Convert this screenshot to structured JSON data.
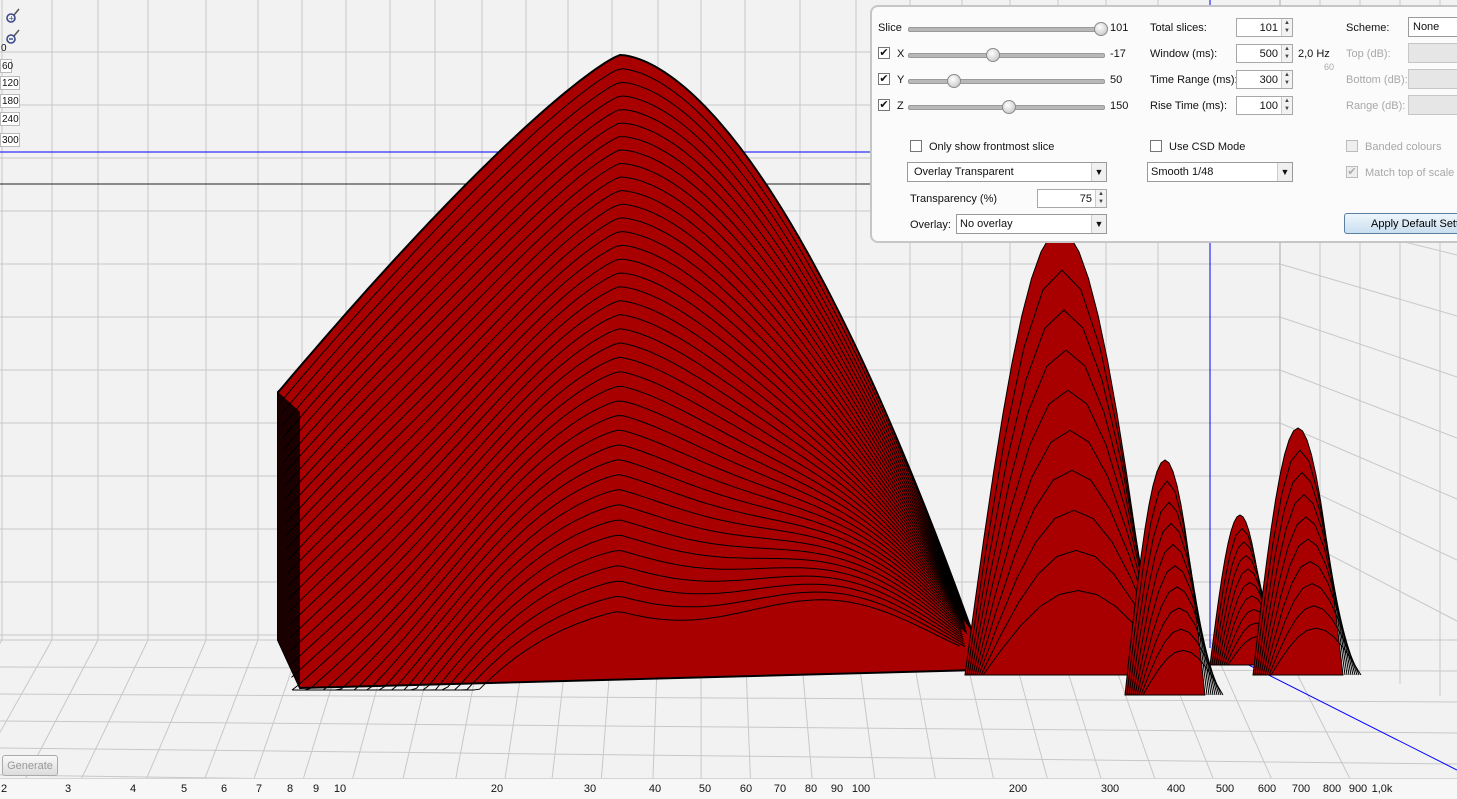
{
  "zoom": {
    "in_icon": "zoom-in-icon",
    "out_icon": "zoom-out-icon",
    "labels": [
      "0",
      "60",
      "120",
      "180",
      "240",
      "300"
    ]
  },
  "colors": {
    "fill": "#a80000",
    "edge": "#000000",
    "grid": "#c8c8c8",
    "blue_line": "#0000ff"
  },
  "axis_ticks": [
    "2",
    "3",
    "4",
    "5",
    "6",
    "7",
    "8",
    "9",
    "10",
    "20",
    "30",
    "40",
    "50",
    "60",
    "70",
    "80",
    "90",
    "100",
    "200",
    "300",
    "400",
    "500",
    "600",
    "700",
    "800",
    "900",
    "1,0k"
  ],
  "generate_label": "Generate",
  "panel": {
    "slice": {
      "label": "Slice",
      "value": "101",
      "fraction": 1.0
    },
    "x": {
      "label": "X",
      "value": "-17",
      "checked": true,
      "fraction": 0.42
    },
    "y": {
      "label": "Y",
      "value": "50",
      "checked": true,
      "fraction": 0.22
    },
    "z": {
      "label": "Z",
      "value": "150",
      "checked": true,
      "fraction": 0.5
    },
    "total_slices": {
      "label": "Total slices:",
      "value": "101"
    },
    "window": {
      "label": "Window (ms):",
      "value": "500",
      "hz": "2,0 Hz"
    },
    "time_range": {
      "label": "Time Range (ms):",
      "value": "300"
    },
    "rise_time": {
      "label": "Rise Time (ms):",
      "value": "100"
    },
    "scheme": {
      "label": "Scheme:",
      "value": "None"
    },
    "top_db": {
      "label": "Top (dB):"
    },
    "bottom_db": {
      "label": "Bottom (dB):"
    },
    "range_db": {
      "label": "Range (dB):"
    },
    "bg_60": "60",
    "bg_120": "120",
    "only_frontmost": {
      "label": "Only show frontmost slice",
      "checked": false
    },
    "use_csd": {
      "label": "Use CSD Mode",
      "checked": false
    },
    "banded": {
      "label": "Banded colours",
      "checked": false
    },
    "match_top": {
      "label": "Match top of scale",
      "checked": true
    },
    "overlay_mode": "Overlay Transparent",
    "smoothing": "Smooth 1/48",
    "transparency": {
      "label": "Transparency (%)",
      "value": "75"
    },
    "overlay": {
      "label": "Overlay:",
      "value": "No overlay"
    },
    "apply_default": "Apply Default Settings"
  }
}
